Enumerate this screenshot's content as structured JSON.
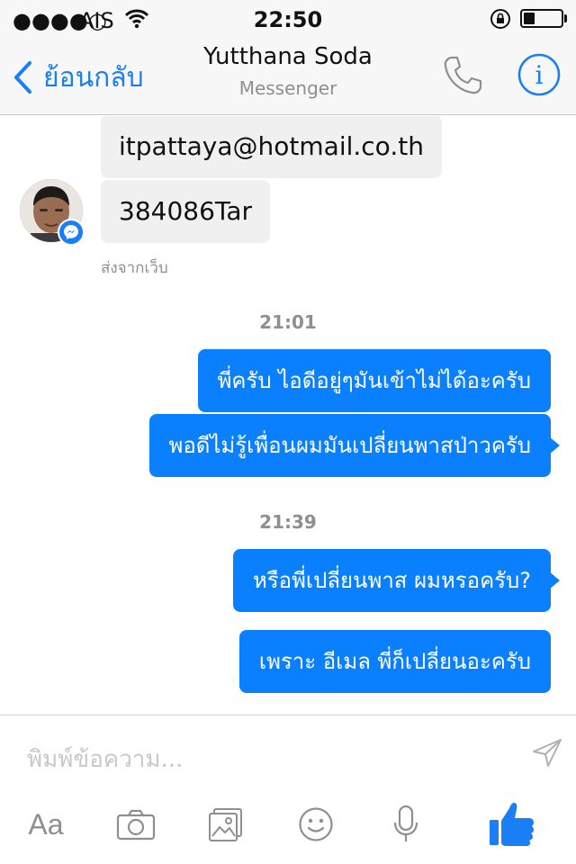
{
  "status_bar": {
    "signal": "●●●●○",
    "carrier": "AIS",
    "time": "22:50",
    "battery_level": 0.3
  },
  "nav": {
    "back_label": "ย้อนกลับ",
    "title": "Yutthana Soda",
    "subtitle": "Messenger"
  },
  "messages_incoming": [
    {
      "text": "itpattaya@hotmail.co.th"
    },
    {
      "text": "384086Tar"
    }
  ],
  "sent_from_label": "ส่งจากเว็บ",
  "timestamps": [
    "21:01",
    "21:39"
  ],
  "messages_outgoing": [
    {
      "text": "พี่ครับ ไอดีอยู่ๆมันเข้าไม่ได้อะครับ"
    },
    {
      "text": "พอดีไม่รู้เพื่อนผมมันเปลี่ยนพาสป่าวครับ"
    },
    {
      "text": "หรือพี่เปลี่ยนพาส ผมหรอครับ?"
    },
    {
      "text": "เพราะ อีเมล พี่ก็เปลี่ยนอะครับ"
    }
  ],
  "composer": {
    "placeholder": "พิมพ์ข้อความ...",
    "font_button_label": "Aa"
  },
  "colors": {
    "accent": "#1a7ef5",
    "outgoing_bubble": "#0a80ff",
    "incoming_bubble": "#f1f0f0",
    "muted_text": "#8e8e93"
  }
}
